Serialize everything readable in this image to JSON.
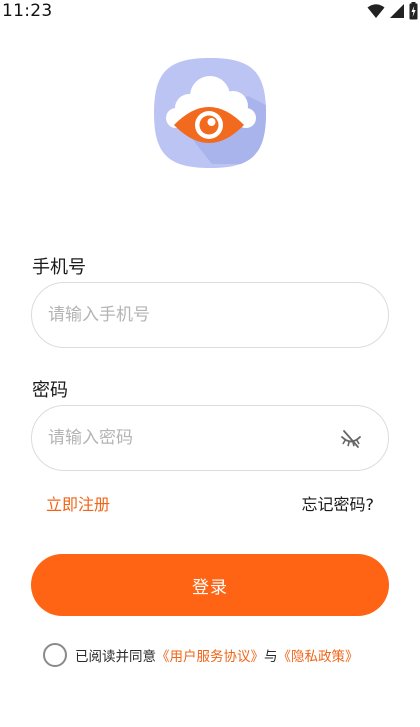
{
  "status_bar": {
    "time": "11:23",
    "icons": [
      "wifi-icon",
      "signal-icon",
      "battery-charging-icon"
    ]
  },
  "logo": {
    "icon": "cloud-eye-logo"
  },
  "phone": {
    "label": "手机号",
    "placeholder": "请输入手机号",
    "value": ""
  },
  "password": {
    "label": "密码",
    "placeholder": "请输入密码",
    "value": "",
    "toggle_icon": "eye-off-icon"
  },
  "links": {
    "register": "立即注册",
    "forgot": "忘记密码?"
  },
  "login_button": {
    "label": "登录"
  },
  "agreement": {
    "prefix": "已阅读并同意",
    "user_agreement": "《用户服务协议》",
    "conjunction": "与",
    "privacy_policy": "《隐私政策》",
    "checked": false
  },
  "colors": {
    "accent": "#ff6414",
    "link": "#f06418",
    "input_border": "#dcdcdc",
    "placeholder": "#b4b4b4"
  }
}
